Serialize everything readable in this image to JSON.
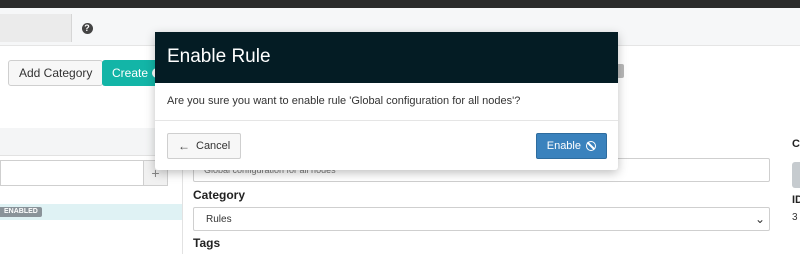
{
  "topbar": {
    "help_icon": "question-circle-icon",
    "help_glyph": "?"
  },
  "toolbar": {
    "add_category_label": "Add Category",
    "create_label": "Create"
  },
  "left_panel": {
    "add_glyph": "+",
    "status_badge": "ENABLED"
  },
  "form": {
    "name_value": "Global configuration for all nodes",
    "category_label": "Category",
    "category_value": "Rules",
    "tags_label": "Tags"
  },
  "right_panel": {
    "heading_fragment": "C",
    "id_label": "ID",
    "id_fragment": "3"
  },
  "modal": {
    "title": "Enable Rule",
    "message": "Are you sure you want to enable rule 'Global configuration for all nodes'?",
    "cancel_label": "Cancel",
    "enable_label": "Enable",
    "cancel_icon": "arrow-left-icon",
    "enable_icon": "ban-icon"
  },
  "colors": {
    "modal_header": "#041c24",
    "primary_button": "#3a82bd",
    "create_button": "#13b5a7",
    "badge": "#8a9399"
  }
}
